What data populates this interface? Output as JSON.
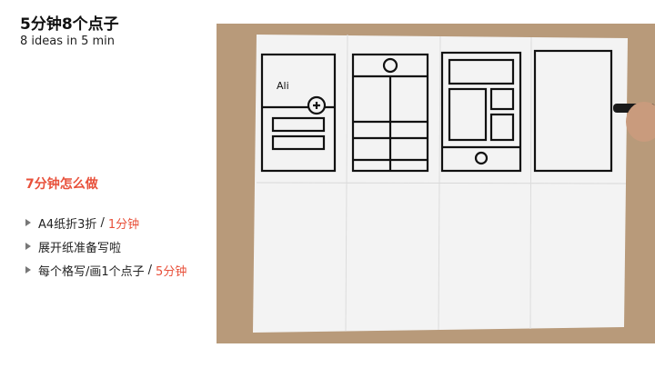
{
  "slide": {
    "title": "5分钟8个点子",
    "subtitle": "8 ideas in 5 min",
    "section_heading": "7分钟怎么做",
    "steps": [
      {
        "text": "A4纸折3折",
        "sep": "/",
        "highlight": "1分钟"
      },
      {
        "text": "展开纸准备写啦",
        "sep": "",
        "highlight": ""
      },
      {
        "text": "每个格写/画1个点子",
        "sep": "/",
        "highlight": "5分钟"
      }
    ]
  },
  "photo": {
    "sketch_label": "Ali"
  },
  "colors": {
    "accent": "#e8503a",
    "text": "#222222",
    "table": "#b89a7a",
    "paper": "#f3f3f3"
  }
}
